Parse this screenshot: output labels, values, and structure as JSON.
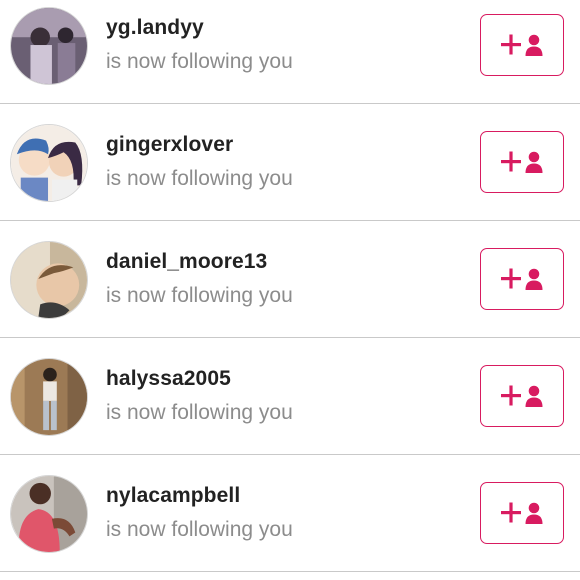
{
  "colors": {
    "accent": "#d81b60",
    "username": "#222222",
    "subtitle": "#8c8c8c",
    "divider": "#c9c9c9"
  },
  "notifications": [
    {
      "username": "yg.landyy",
      "message": "is now following you",
      "action_icon": "add-user-icon"
    },
    {
      "username": "gingerxlover",
      "message": "is now following you",
      "action_icon": "add-user-icon"
    },
    {
      "username": "daniel_moore13",
      "message": "is now following you",
      "action_icon": "add-user-icon"
    },
    {
      "username": "halyssa2005",
      "message": "is now following you",
      "action_icon": "add-user-icon"
    },
    {
      "username": "nylacampbell",
      "message": "is now following you",
      "action_icon": "add-user-icon"
    }
  ]
}
